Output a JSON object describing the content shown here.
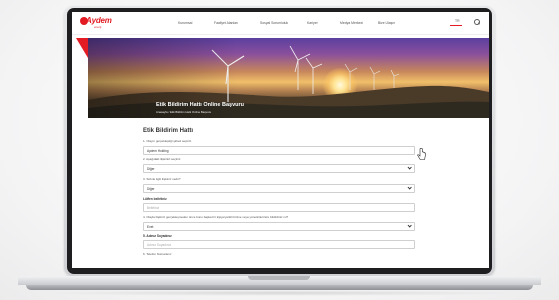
{
  "brand": {
    "name": "Aydem",
    "sub": "enerji",
    "accent": "#e31b23"
  },
  "nav": {
    "items": [
      "Kurumsal",
      "Faaliyet Alanları",
      "Sosyal Sorumluluk",
      "Kariyer",
      "Medya Merkezi",
      "Bize Ulaşın"
    ]
  },
  "header": {
    "language": "TR"
  },
  "hero": {
    "title": "Etik Bildirim Hattı Online Başvuru",
    "breadcrumb": "Anasayfa / Etik Bildirim Hattı Online Başvuru"
  },
  "form": {
    "title": "Etik Bildirim Hattı",
    "q1": "1. Olayın gerçekleştiği şirketi seçiniz.",
    "q1_value": "Aydem Holding",
    "q2": "2. Aşağıdaki ilişkinizi seçiniz.",
    "q2_value": "Diğer",
    "q3": "3. Sizinle ilgili ilişkiniz nedir?",
    "q3_value": "Diğer",
    "q3_detail_label": "Lütfen belirtiniz",
    "q3_detail_placeholder": "Belirtiniz",
    "q4": "4. Olayla ilişkiniz gerçekleşmeden önce bunu başka bir kişiye/yetkili birime veya yöneticilerinize bildirdiniz mi?",
    "q4_value": "Evet",
    "q5": "5. Adınız Soyadınız",
    "q5_placeholder": "Adınız Soyadınız",
    "q6": "6. Telefon Numaranız"
  }
}
